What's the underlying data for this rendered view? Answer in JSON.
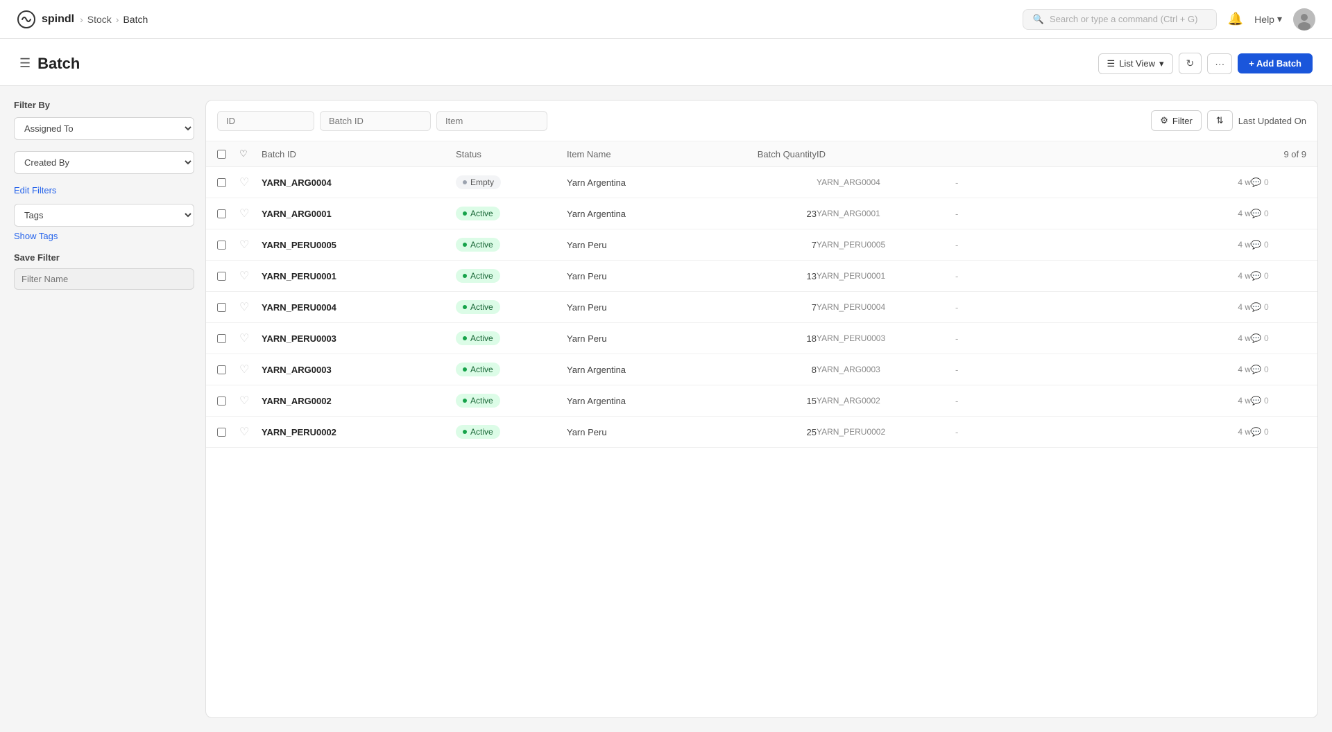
{
  "app": {
    "name": "spindl",
    "breadcrumb": [
      "Stock",
      "Batch"
    ]
  },
  "topbar": {
    "search_placeholder": "Search or type a command (Ctrl + G)",
    "help_label": "Help"
  },
  "page": {
    "title": "Batch",
    "list_view_label": "List View",
    "add_batch_label": "+ Add Batch"
  },
  "sidebar": {
    "filter_by_label": "Filter By",
    "assigned_to_label": "Assigned To",
    "created_by_label": "Created By",
    "edit_filters_label": "Edit Filters",
    "tags_label": "Tags",
    "show_tags_label": "Show Tags",
    "save_filter_label": "Save Filter",
    "filter_name_placeholder": "Filter Name"
  },
  "table": {
    "search_id_placeholder": "ID",
    "search_batch_id_placeholder": "Batch ID",
    "search_item_placeholder": "Item",
    "filter_label": "Filter",
    "sort_label": "Last Updated On",
    "columns": {
      "batch_id": "Batch ID",
      "status": "Status",
      "item_name": "Item Name",
      "batch_quantity": "Batch Quantity",
      "id": "ID",
      "count": "9 of 9"
    },
    "rows": [
      {
        "batch_id": "YARN_ARG0004",
        "status": "Empty",
        "status_type": "empty",
        "item_name": "Yarn Argentina",
        "batch_quantity": "",
        "id": "YARN_ARG0004",
        "time": "4 w",
        "comments": "0"
      },
      {
        "batch_id": "YARN_ARG0001",
        "status": "Active",
        "status_type": "active",
        "item_name": "Yarn Argentina",
        "batch_quantity": "23",
        "id": "YARN_ARG0001",
        "time": "4 w",
        "comments": "0"
      },
      {
        "batch_id": "YARN_PERU0005",
        "status": "Active",
        "status_type": "active",
        "item_name": "Yarn Peru",
        "batch_quantity": "7",
        "id": "YARN_PERU0005",
        "time": "4 w",
        "comments": "0"
      },
      {
        "batch_id": "YARN_PERU0001",
        "status": "Active",
        "status_type": "active",
        "item_name": "Yarn Peru",
        "batch_quantity": "13",
        "id": "YARN_PERU0001",
        "time": "4 w",
        "comments": "0"
      },
      {
        "batch_id": "YARN_PERU0004",
        "status": "Active",
        "status_type": "active",
        "item_name": "Yarn Peru",
        "batch_quantity": "7",
        "id": "YARN_PERU0004",
        "time": "4 w",
        "comments": "0"
      },
      {
        "batch_id": "YARN_PERU0003",
        "status": "Active",
        "status_type": "active",
        "item_name": "Yarn Peru",
        "batch_quantity": "18",
        "id": "YARN_PERU0003",
        "time": "4 w",
        "comments": "0"
      },
      {
        "batch_id": "YARN_ARG0003",
        "status": "Active",
        "status_type": "active",
        "item_name": "Yarn Argentina",
        "batch_quantity": "8",
        "id": "YARN_ARG0003",
        "time": "4 w",
        "comments": "0"
      },
      {
        "batch_id": "YARN_ARG0002",
        "status": "Active",
        "status_type": "active",
        "item_name": "Yarn Argentina",
        "batch_quantity": "15",
        "id": "YARN_ARG0002",
        "time": "4 w",
        "comments": "0"
      },
      {
        "batch_id": "YARN_PERU0002",
        "status": "Active",
        "status_type": "active",
        "item_name": "Yarn Peru",
        "batch_quantity": "25",
        "id": "YARN_PERU0002",
        "time": "4 w",
        "comments": "0"
      }
    ]
  }
}
